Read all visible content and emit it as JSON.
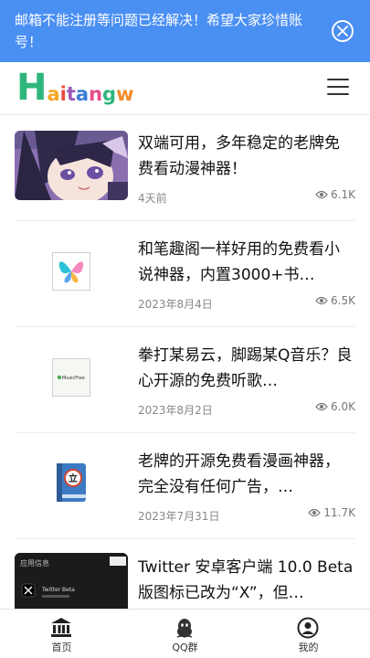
{
  "notice": {
    "text": "邮箱不能注册等问题已经解决！希望大家珍惜账号！",
    "close_icon": "close-circle-icon",
    "background": "#4a8ff2"
  },
  "header": {
    "logo_first": "H",
    "logo_letters": [
      "a",
      "i",
      "t",
      "a",
      "n",
      "g",
      "w"
    ],
    "logo_colors": [
      "#f5a623",
      "#e84b3c",
      "#9b59b6",
      "#3a7bd5",
      "#e84b8a",
      "#2fb67c",
      "#f08c2a"
    ],
    "menu_icon": "hamburger-menu-icon"
  },
  "articles": [
    {
      "title": "双端可用，多年稳定的老牌免费看动漫神器！",
      "date": "4天前",
      "views": "6.1K"
    },
    {
      "title": "和笔趣阁一样好用的免费看小说神器，内置3000+书…",
      "date": "2023年8月4日",
      "views": "6.5K"
    },
    {
      "title": "拳打某易云，脚踢某Q音乐？良心开源的免费听歌…",
      "date": "2023年8月2日",
      "views": "6.0K"
    },
    {
      "title": "老牌的开源免费看漫画神器，完全没有任何广告，…",
      "date": "2023年7月31日",
      "views": "11.7K"
    },
    {
      "title": "Twitter 安卓客户端 10.0 Beta 版图标已改为“X”，但…",
      "date": "",
      "views": ""
    }
  ],
  "thumb_texts": {
    "music_app": "MusicFree",
    "app_info": "应用信息",
    "twitter_beta": "Twitter Beta"
  },
  "tabbar": {
    "items": [
      {
        "label": "首页",
        "icon": "bank-icon"
      },
      {
        "label": "QQ群",
        "icon": "qq-penguin-icon"
      },
      {
        "label": "我的",
        "icon": "user-icon"
      }
    ]
  }
}
